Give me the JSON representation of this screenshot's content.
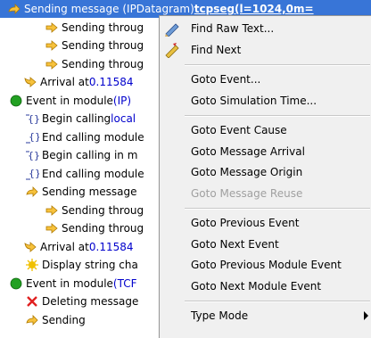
{
  "tree": {
    "rows": [
      {
        "icon": "send-arrow-icon",
        "parts": [
          {
            "t": "Sending message ("
          },
          {
            "t": "IPDatagram",
            "c": "blue"
          },
          {
            "t": ") "
          },
          {
            "t": "tcpseg(l=1024,0m=",
            "c": "bold"
          }
        ],
        "selected": true
      },
      {
        "icon": "pass-arrow-icon",
        "parts": [
          {
            "t": "Sending throug"
          }
        ]
      },
      {
        "icon": "pass-arrow-icon",
        "parts": [
          {
            "t": "Sending throug"
          }
        ]
      },
      {
        "icon": "pass-arrow-icon",
        "parts": [
          {
            "t": "Sending throug"
          }
        ]
      },
      {
        "icon": "arrival-arrow-icon",
        "parts": [
          {
            "t": "Arrival at "
          },
          {
            "t": "0.11584",
            "c": "blue"
          }
        ]
      },
      {
        "icon": "event-dot-icon",
        "parts": [
          {
            "t": "Event in module "
          },
          {
            "t": "(IP)",
            "c": "blue"
          }
        ]
      },
      {
        "icon": "begin-call-icon",
        "parts": [
          {
            "t": "Begin calling "
          },
          {
            "t": "local",
            "c": "blue"
          }
        ]
      },
      {
        "icon": "end-call-icon",
        "parts": [
          {
            "t": "End calling module"
          }
        ]
      },
      {
        "icon": "begin-call-icon",
        "parts": [
          {
            "t": "Begin calling  in m"
          }
        ]
      },
      {
        "icon": "end-call-icon",
        "parts": [
          {
            "t": "End calling module"
          }
        ]
      },
      {
        "icon": "send-arrow-icon",
        "parts": [
          {
            "t": "Sending message"
          }
        ]
      },
      {
        "icon": "pass-arrow-icon",
        "parts": [
          {
            "t": "Sending throug"
          }
        ]
      },
      {
        "icon": "pass-arrow-icon",
        "parts": [
          {
            "t": "Sending throug"
          }
        ]
      },
      {
        "icon": "arrival-arrow-icon",
        "parts": [
          {
            "t": "Arrival at "
          },
          {
            "t": "0.11584",
            "c": "blue"
          }
        ]
      },
      {
        "icon": "display-string-icon",
        "parts": [
          {
            "t": "Display string cha"
          }
        ]
      },
      {
        "icon": "event-dot-icon",
        "parts": [
          {
            "t": "Event in module "
          },
          {
            "t": "(TCF",
            "c": "blue"
          }
        ]
      },
      {
        "icon": "delete-x-icon",
        "parts": [
          {
            "t": "Deleting message"
          }
        ]
      },
      {
        "icon": "send-arrow-icon",
        "parts": [
          {
            "t": "Sending"
          }
        ]
      }
    ]
  },
  "menu": {
    "items": [
      {
        "label": "Find Raw Text...",
        "icon": "find-text-icon"
      },
      {
        "label": "Find Next",
        "icon": "find-next-icon"
      },
      {
        "sep": true
      },
      {
        "label": "Goto Event..."
      },
      {
        "label": "Goto Simulation Time..."
      },
      {
        "sep": true
      },
      {
        "label": "Goto Event Cause"
      },
      {
        "label": "Goto Message Arrival"
      },
      {
        "label": "Goto Message Origin"
      },
      {
        "label": "Goto Message Reuse",
        "disabled": true
      },
      {
        "sep": true
      },
      {
        "label": "Goto Previous Event"
      },
      {
        "label": "Goto Next Event"
      },
      {
        "label": "Goto Previous Module Event"
      },
      {
        "label": "Goto Next Module Event"
      },
      {
        "sep": true
      },
      {
        "label": "Type Mode",
        "submenu": true
      }
    ]
  }
}
